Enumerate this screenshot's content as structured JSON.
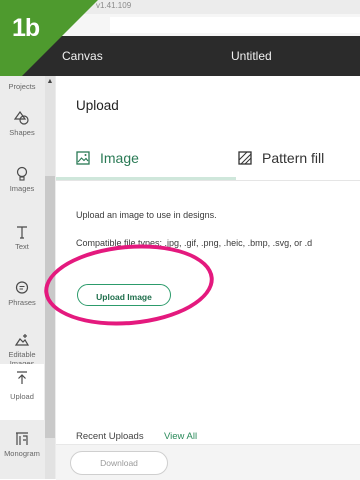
{
  "badge": {
    "label": "1b",
    "color": "#4e9a2e"
  },
  "topstrip": {
    "version": "v1.41.109"
  },
  "header": {
    "app_name": "Canvas",
    "doc_title": "Untitled"
  },
  "sidebar": {
    "items": [
      {
        "label": "Projects",
        "icon": "projects-icon"
      },
      {
        "label": "Shapes",
        "icon": "shapes-icon"
      },
      {
        "label": "Images",
        "icon": "lightbulb-icon"
      },
      {
        "label": "Text",
        "icon": "text-icon"
      },
      {
        "label": "Phrases",
        "icon": "speech-bubble-icon"
      },
      {
        "label": "Editable Images",
        "icon": "editable-images-icon"
      },
      {
        "label": "Upload",
        "icon": "upload-icon"
      },
      {
        "label": "Monogram",
        "icon": "monogram-icon"
      }
    ]
  },
  "panel": {
    "title": "Upload",
    "tabs": [
      {
        "label": "Image",
        "icon": "image-icon"
      },
      {
        "label": "Pattern fill",
        "icon": "pattern-icon"
      }
    ],
    "description": "Upload an image to use in designs.",
    "file_types": "Compatible file types: .jpg, .gif, .png, .heic, .bmp, .svg, or .d",
    "upload_button": "Upload Image",
    "recent_label": "Recent Uploads",
    "view_all": "View All",
    "download_button": "Download"
  },
  "colors": {
    "accent": "#2c9b6b",
    "highlight_circle": "#e4197e",
    "header_bg": "#2b2b2b"
  }
}
